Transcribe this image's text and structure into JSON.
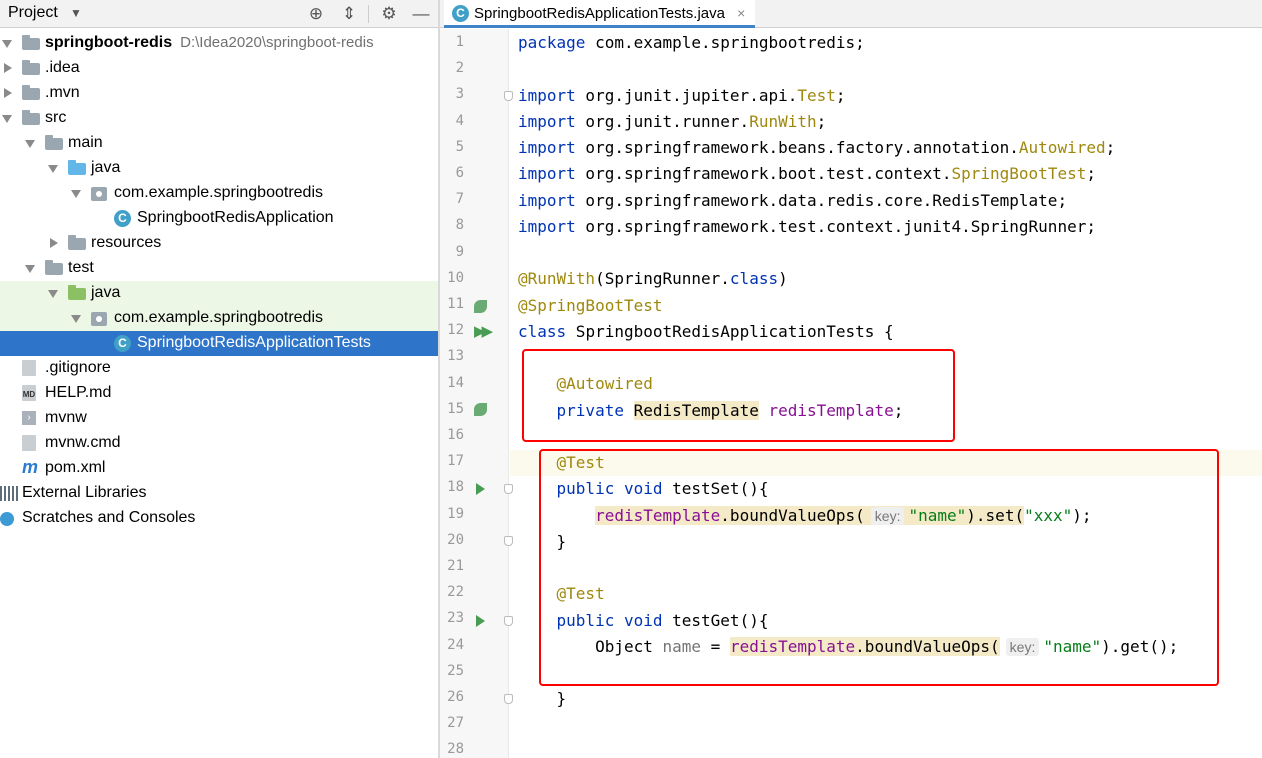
{
  "project": {
    "title": "Project",
    "tree": [
      {
        "label": "springboot-redis",
        "path": "D:\\Idea2020\\springboot-redis",
        "depth": 0,
        "arrow": "down",
        "icon": "module-folder-icon",
        "bold": true
      },
      {
        "label": ".idea",
        "depth": 0,
        "arrow": "right",
        "icon": "folder-icon"
      },
      {
        "label": ".mvn",
        "depth": 0,
        "arrow": "right",
        "icon": "folder-icon"
      },
      {
        "label": "src",
        "depth": 0,
        "arrow": "down",
        "icon": "folder-icon"
      },
      {
        "label": "main",
        "depth": 1,
        "arrow": "down",
        "icon": "folder-icon"
      },
      {
        "label": "java",
        "depth": 2,
        "arrow": "down",
        "icon": "source-folder-icon"
      },
      {
        "label": "com.example.springbootredis",
        "depth": 3,
        "arrow": "down",
        "icon": "package-icon"
      },
      {
        "label": "SpringbootRedisApplication",
        "depth": 4,
        "arrow": "none",
        "icon": "spring-class-icon"
      },
      {
        "label": "resources",
        "depth": 2,
        "arrow": "right",
        "icon": "resources-folder-icon"
      },
      {
        "label": "test",
        "depth": 1,
        "arrow": "down",
        "icon": "folder-icon"
      },
      {
        "label": "java",
        "depth": 2,
        "arrow": "down",
        "icon": "test-folder-icon",
        "highlight": true
      },
      {
        "label": "com.example.springbootredis",
        "depth": 3,
        "arrow": "down",
        "icon": "package-icon",
        "highlight": true
      },
      {
        "label": "SpringbootRedisApplicationTests",
        "depth": 4,
        "arrow": "none",
        "icon": "spring-class-icon",
        "selected": true
      },
      {
        "label": ".gitignore",
        "depth": 0,
        "arrow": "none",
        "icon": "gitignore-file-icon"
      },
      {
        "label": "HELP.md",
        "depth": 0,
        "arrow": "none",
        "icon": "markdown-file-icon"
      },
      {
        "label": "mvnw",
        "depth": 0,
        "arrow": "none",
        "icon": "script-file-icon"
      },
      {
        "label": "mvnw.cmd",
        "depth": 0,
        "arrow": "none",
        "icon": "text-file-icon"
      },
      {
        "label": "pom.xml",
        "depth": 0,
        "arrow": "none",
        "icon": "maven-file-icon"
      },
      {
        "label": "External Libraries",
        "depth": -1,
        "arrow": "right",
        "icon": "libraries-icon"
      },
      {
        "label": "Scratches and Consoles",
        "depth": -1,
        "arrow": "right",
        "icon": "scratches-icon"
      }
    ]
  },
  "editor": {
    "tab_label": "SpringbootRedisApplicationTests.java",
    "tab_close": "×",
    "line_numbers": [
      "1",
      "2",
      "3",
      "4",
      "5",
      "6",
      "7",
      "8",
      "9",
      "10",
      "11",
      "12",
      "13",
      "14",
      "15",
      "16",
      "17",
      "18",
      "19",
      "20",
      "21",
      "22",
      "23",
      "24",
      "25",
      "26",
      "27",
      "28"
    ],
    "code": {
      "l1_kw": "package",
      "l1_rest": " com.example.springbootredis;",
      "import_kw": "import",
      "l3_a": " org.junit.jupiter.api.",
      "l3_b": "Test",
      "l3_c": ";",
      "l4_a": " org.junit.runner.",
      "l4_b": "RunWith",
      "l4_c": ";",
      "l5_a": " org.springframework.beans.factory.annotation.",
      "l5_b": "Autowired",
      "l5_c": ";",
      "l6_a": " org.springframework.boot.test.context.",
      "l6_b": "SpringBootTest",
      "l6_c": ";",
      "l7_a": " org.springframework.data.redis.core.RedisTemplate;",
      "l8_a": " org.springframework.test.context.junit4.SpringRunner;",
      "l10_a": "@RunWith",
      "l10_b": "(SpringRunner.",
      "l10_c": "class",
      "l10_d": ")",
      "l11_a": "@SpringBootTest",
      "l12_a": "class",
      "l12_b": " SpringbootRedisApplicationTests {",
      "l14_a": "    ",
      "l14_b": "@Autowired",
      "l15_a": "    ",
      "l15_b": "private",
      "l15_c": " ",
      "l15_d": "RedisTemplate",
      "l15_e": " ",
      "l15_f": "redisTemplate",
      "l15_g": ";",
      "l17_a": "    ",
      "l17_b": "@Test",
      "l18_a": "    ",
      "l18_b": "public",
      "l18_c": " ",
      "l18_d": "void",
      "l18_e": " testSet(){",
      "l19_a": "        ",
      "l19_b": "redisTemplate",
      "l19_c": ".boundValueOps(",
      "l19_hint": "key:",
      "l19_d": "\"name\"",
      "l19_e": ").set(",
      "l19_f": "\"xxx\"",
      "l19_g": ");",
      "l20_a": "    }",
      "l22_a": "    ",
      "l22_b": "@Test",
      "l23_a": "    ",
      "l23_b": "public",
      "l23_c": " ",
      "l23_d": "void",
      "l23_e": " testGet(){",
      "l24_a": "        Object ",
      "l24_b": "name",
      "l24_c": " = ",
      "l24_d": "redisTemplate",
      "l24_e": ".boundValueOps(",
      "l24_hint": "key:",
      "l24_f": "\"name\"",
      "l24_g": ").get();",
      "l26_a": "    }"
    }
  },
  "colors": {
    "selection": "#2e75c9",
    "keyword": "#0033b3",
    "annotation": "#9e880d",
    "field": "#871094",
    "string": "#067d17",
    "red_box": "#ff0000"
  }
}
